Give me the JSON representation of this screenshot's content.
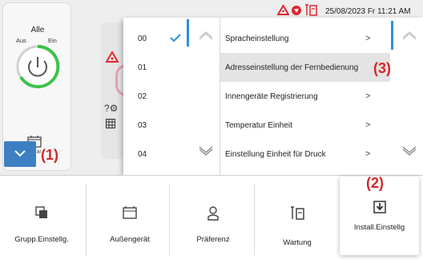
{
  "status": {
    "datetime": "25/08/2023 Fr 11:21 AM",
    "icons": [
      "warning-icon",
      "setting-icon",
      "tool-icon"
    ]
  },
  "left_panel": {
    "title": "Alle",
    "off_label": "Aus",
    "on_label": "Ein",
    "partial_label": "ular"
  },
  "address_list": {
    "items": [
      "00",
      "01",
      "02",
      "03",
      "04"
    ],
    "selected": "00"
  },
  "settings_menu": {
    "items": [
      "Spracheinstellung",
      "Adresseinstellung der Fernbedienung",
      "Innengeräte Registrierung",
      "Temperatur Einheit",
      "Einstellung Einheit für Druck"
    ],
    "selected_index": 1,
    "arrow": ">"
  },
  "annotations": {
    "one": "(1)",
    "two": "(2)",
    "three": "(3)"
  },
  "bottom_tabs": [
    {
      "label": "Grupp.Einstellg.",
      "icon": "group-icon"
    },
    {
      "label": "Außengerät",
      "icon": "outdoor-unit-icon"
    },
    {
      "label": "Präferenz",
      "icon": "preference-icon"
    },
    {
      "label": "Wartung",
      "icon": "maintenance-icon"
    },
    {
      "label": "Install.Einstellg",
      "icon": "install-icon"
    }
  ],
  "colors": {
    "accent": "#3d7fc2",
    "scroll": "#2d8fe0",
    "check": "#2d8fe0",
    "annotation": "#d7262a",
    "power": "#3cc24a",
    "warning": "#e0262f"
  }
}
